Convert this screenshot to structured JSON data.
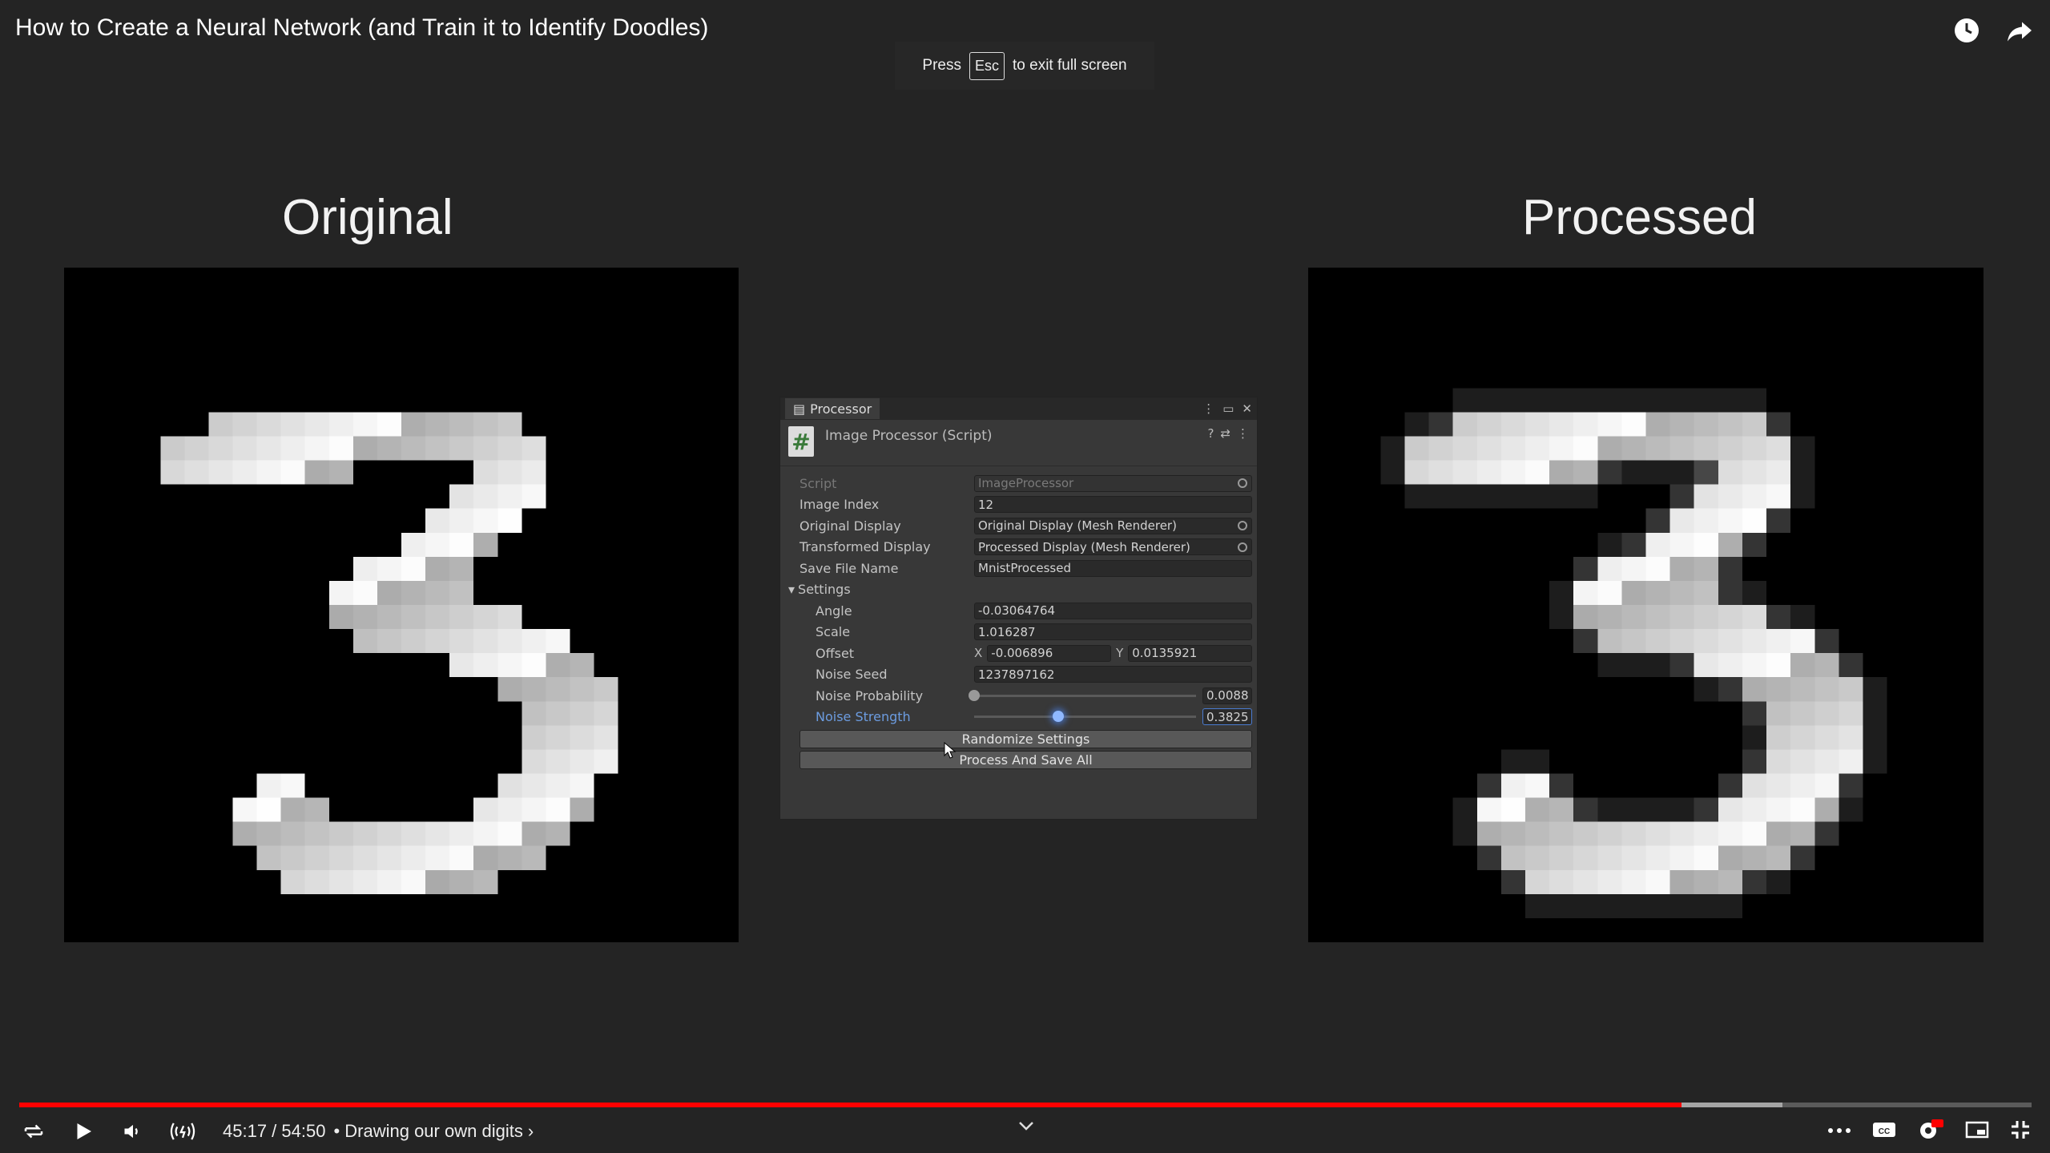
{
  "video": {
    "title": "How to Create a Neural Network (and Train it to Identify Doodles)",
    "fullscreen_toast": {
      "before": "Press",
      "key": "Esc",
      "after": "to exit full screen"
    },
    "time_current": "45:17",
    "time_total": "54:50",
    "time_display": "45:17 / 54:50",
    "chapter": "• Drawing our own digits ›",
    "progress_played_fraction": 0.826,
    "progress_buffered_fraction": 0.876
  },
  "panels": {
    "original_title": "Original",
    "processed_title": "Processed"
  },
  "inspector": {
    "tab_label": "Processor",
    "component_name": "Image Processor (Script)",
    "fields": {
      "script_label": "Script",
      "script_value": "ImageProcessor",
      "image_index_label": "Image Index",
      "image_index_value": "12",
      "original_display_label": "Original Display",
      "original_display_value": "Original Display (Mesh Renderer)",
      "transformed_display_label": "Transformed Display",
      "transformed_display_value": "Processed Display (Mesh Renderer)",
      "save_file_name_label": "Save File Name",
      "save_file_name_value": "MnistProcessed",
      "settings_label": "Settings",
      "angle_label": "Angle",
      "angle_value": "-0.03064764",
      "scale_label": "Scale",
      "scale_value": "1.016287",
      "offset_label": "Offset",
      "offset_x_label": "X",
      "offset_x_value": "-0.006896",
      "offset_y_label": "Y",
      "offset_y_value": "0.0135921",
      "noise_seed_label": "Noise Seed",
      "noise_seed_value": "1237897162",
      "noise_probability_label": "Noise Probability",
      "noise_probability_value": "0.0088",
      "noise_probability_fraction": 0.0,
      "noise_strength_label": "Noise Strength",
      "noise_strength_value": "0.3825",
      "noise_strength_fraction": 0.38
    },
    "buttons": {
      "randomize": "Randomize Settings",
      "process_save": "Process And Save All"
    }
  },
  "colors": {
    "accent_progress": "#ff0000",
    "background": "#242424",
    "inspector_bg": "#383838"
  },
  "icons": [
    "watch-later-icon",
    "share-icon",
    "loop-icon",
    "play-icon",
    "volume-icon",
    "live-radio-icon",
    "more-icon",
    "captions-icon",
    "settings-hd-icon",
    "miniplayer-icon",
    "exit-fullscreen-icon",
    "script-icon",
    "cursor-icon"
  ]
}
